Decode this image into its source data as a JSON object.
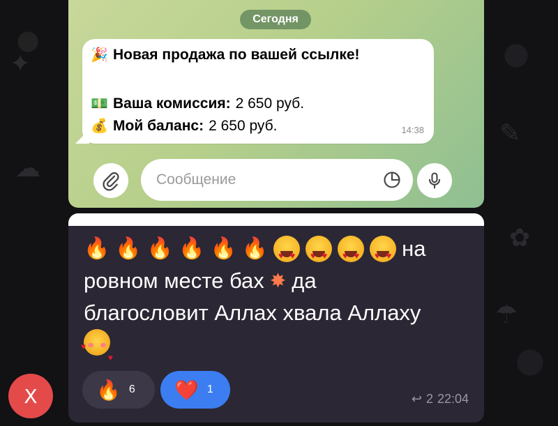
{
  "top_chat": {
    "date_pill": "Сегодня",
    "message": {
      "title": "Новая продажа по вашей ссылке!",
      "commission_label": "Ваша комиссия:",
      "commission_value": "2 650 руб.",
      "balance_label": "Мой баланс:",
      "balance_value": "2 650 руб.",
      "time": "14:38"
    },
    "input": {
      "placeholder": "Сообщение"
    },
    "icons": {
      "attach": "paperclip-icon",
      "sticker": "sticker-icon",
      "mic": "microphone-icon"
    }
  },
  "bottom_chat": {
    "message_suffix": "на",
    "line2": "ровном месте бах",
    "line2_end": "да",
    "line3": "благословит Аллах хвала Аллаху",
    "reactions": [
      {
        "emoji": "🔥",
        "count": "6"
      },
      {
        "emoji": "❤️",
        "count": "1"
      }
    ],
    "reply_count": "2",
    "time": "22:04"
  },
  "close_button": {
    "label": "X"
  },
  "colors": {
    "close": "#e44a4a",
    "heart_reaction": "#3c7ef2",
    "dark_bubble": "#2b2734"
  }
}
